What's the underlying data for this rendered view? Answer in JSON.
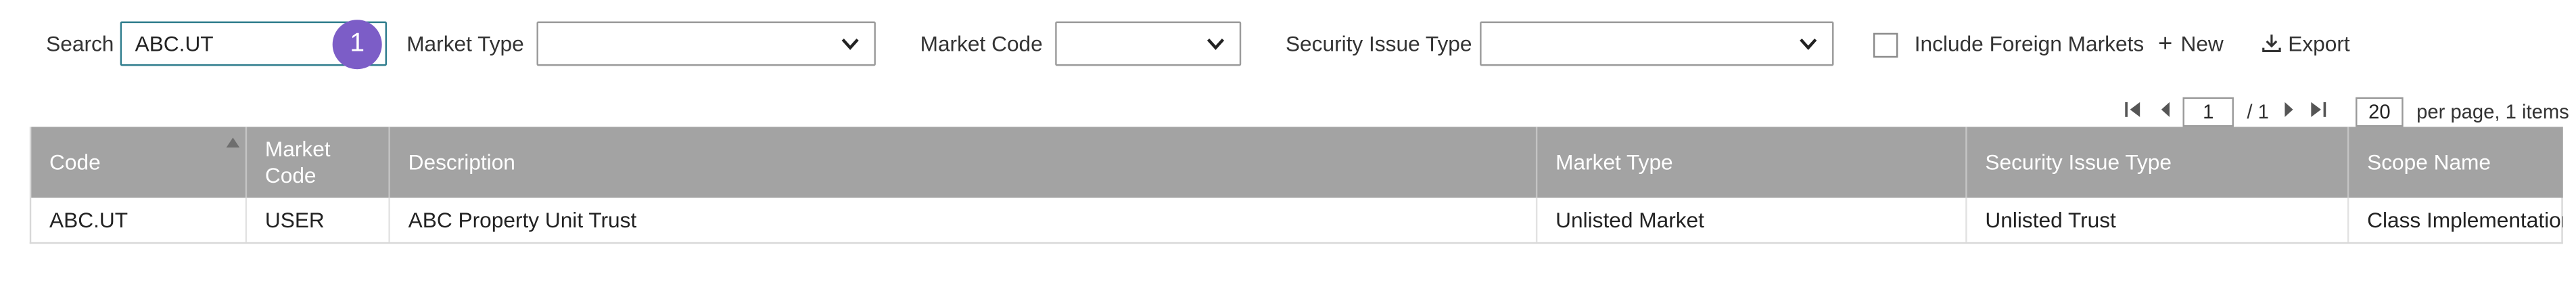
{
  "filters": {
    "search_label": "Search",
    "search_value": "ABC.UT",
    "badge_count": "1",
    "market_type_label": "Market Type",
    "market_type_value": "",
    "market_code_label": "Market Code",
    "market_code_value": "",
    "security_issue_type_label": "Security Issue Type",
    "security_issue_type_value": "",
    "include_foreign_label": "Include Foreign Markets",
    "include_foreign_checked": false
  },
  "actions": {
    "new_label": "New",
    "export_label": "Export"
  },
  "pager": {
    "current_page": "1",
    "total_pages_text": "/ 1",
    "per_page": "20",
    "summary_text": "per page, 1 items"
  },
  "table": {
    "columns": [
      "Code",
      "Market\nCode",
      "Description",
      "Market Type",
      "Security Issue Type",
      "Scope Name"
    ],
    "sort": {
      "column": "Code",
      "direction": "ascending"
    },
    "rows": [
      [
        "ABC.UT",
        "USER",
        "ABC Property Unit Trust",
        "Unlisted Market",
        "Unlisted Trust",
        "Class Implementation"
      ]
    ]
  },
  "colors": {
    "header_bg": "#a3a3a3",
    "badge": "#7c5dc7",
    "search_border": "#2f7d8d"
  },
  "icons": {
    "dropdown": "chevron-down-icon",
    "new": "plus-icon",
    "export": "download-icon",
    "sort": "sort-up-icon",
    "pager": [
      "first-page-icon",
      "prev-page-icon",
      "next-page-icon",
      "last-page-icon"
    ]
  }
}
